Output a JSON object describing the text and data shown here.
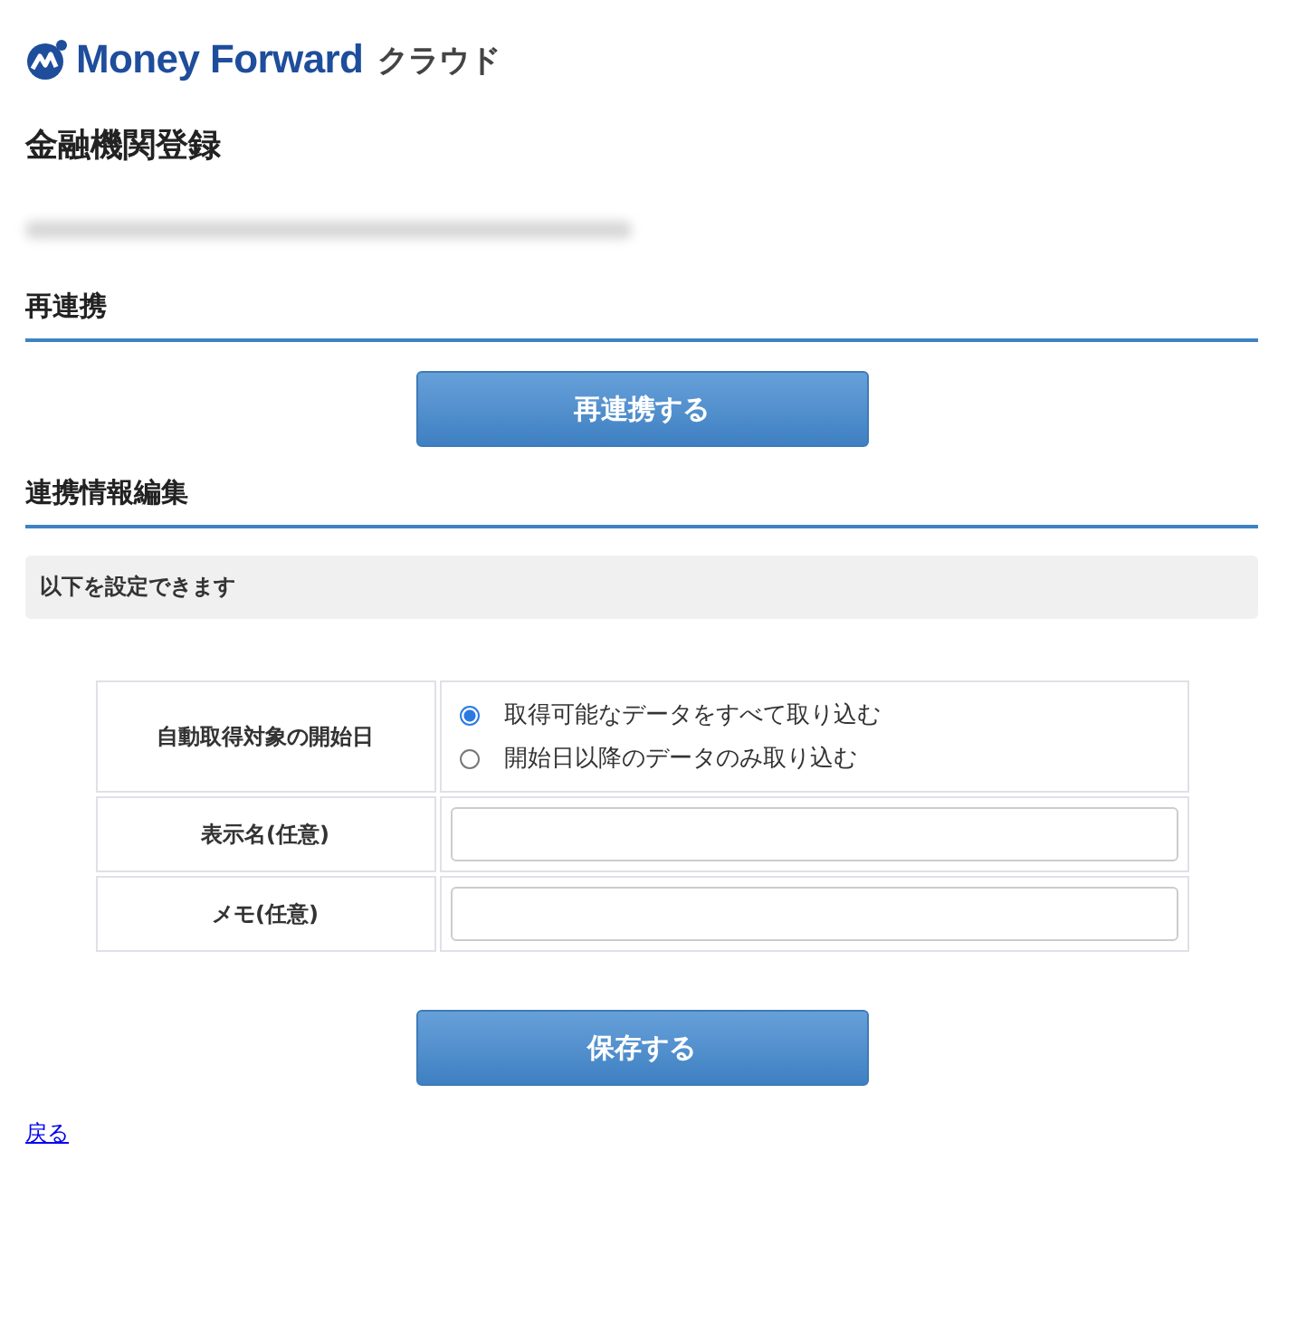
{
  "logo": {
    "brand": "Money Forward",
    "product": "クラウド"
  },
  "title": "金融機関登録",
  "sections": [
    {
      "heading": "再連携",
      "button": "再連携する"
    },
    {
      "heading": "連携情報編集",
      "note": "以下を設定できます"
    }
  ],
  "form": {
    "rows": [
      {
        "kind": "radio",
        "label": "自動取得対象の開始日",
        "options": [
          {
            "label": "取得可能なデータをすべて取り込む",
            "selected": true
          },
          {
            "label": "開始日以降のデータのみ取り込む",
            "selected": false
          }
        ]
      },
      {
        "kind": "text",
        "label": "表示名(任意)"
      },
      {
        "kind": "text",
        "label": "メモ(任意)"
      }
    ]
  },
  "save_button": "保存する",
  "back_link": "戻る"
}
